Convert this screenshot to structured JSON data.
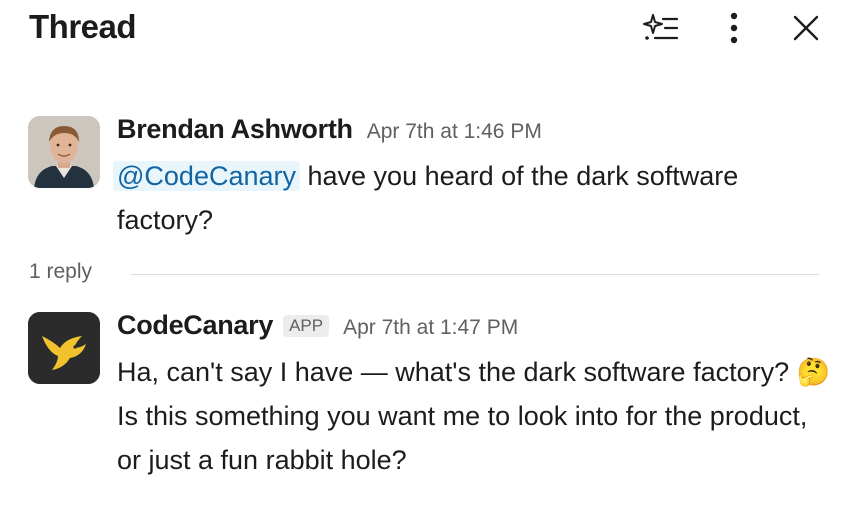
{
  "header": {
    "title": "Thread",
    "icons": [
      "sparkle-list-icon",
      "more-vertical-icon",
      "close-icon"
    ]
  },
  "messages": [
    {
      "author": "Brendan Ashworth",
      "timestamp": "Apr 7th at 1:46 PM",
      "mention": "@CodeCanary",
      "text": " have you heard of the dark software factory?"
    },
    {
      "author": "CodeCanary",
      "badge": "APP",
      "timestamp": "Apr 7th at 1:47 PM",
      "text_before_emoji": "Ha, can't say I have — what's the dark software factory? ",
      "emoji": "🤔",
      "text_after_emoji": " Is this something you want me to look into for the product, or just a fun rabbit hole?"
    }
  ],
  "replies": {
    "count_label": "1 reply"
  },
  "colors": {
    "mention": "#1264a3",
    "mention_bg": "#e8f5fa",
    "bot_avatar_bg": "#2b2b2b",
    "bird": "#f2c12e"
  }
}
